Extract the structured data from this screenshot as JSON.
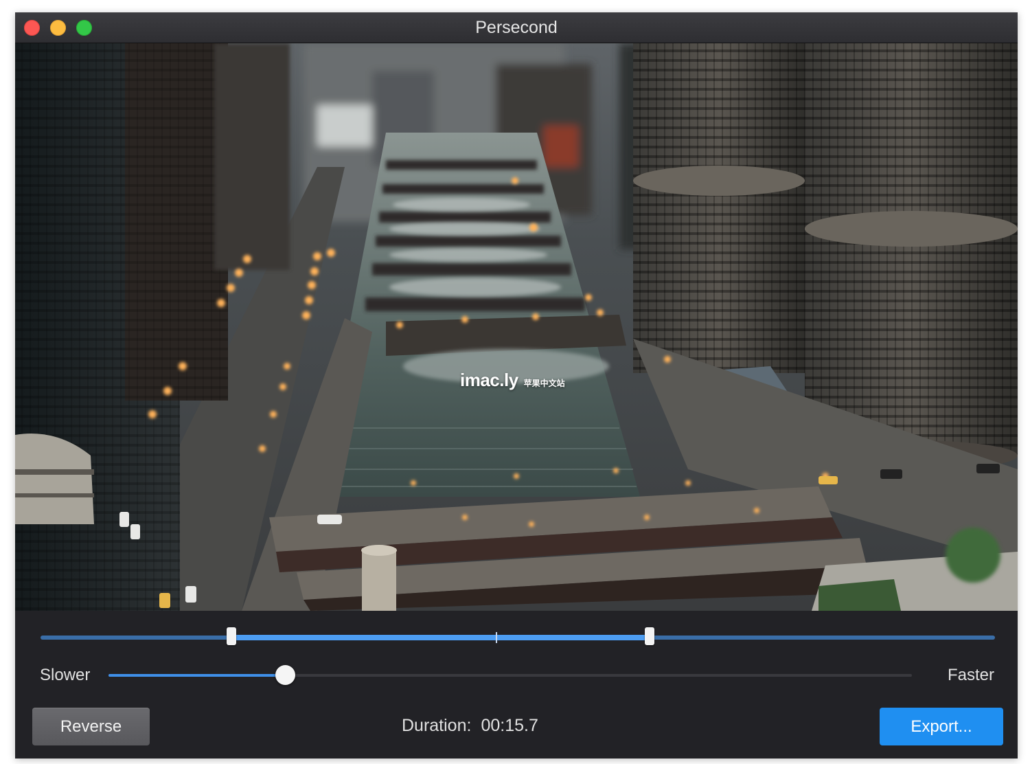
{
  "window": {
    "title": "Persecond"
  },
  "video": {
    "watermark_brand": "imac.ly",
    "watermark_sub": "苹果中文站"
  },
  "trim_range": {
    "start_fraction": 0.2,
    "end_fraction": 0.64
  },
  "speed": {
    "slower_label": "Slower",
    "faster_label": "Faster",
    "value_fraction": 0.22
  },
  "footer": {
    "reverse_label": "Reverse",
    "duration_label": "Duration:",
    "duration_value": "00:15.7",
    "export_label": "Export..."
  },
  "colors": {
    "accent": "#1f8ff1",
    "traffic_close": "#fc5753",
    "traffic_minimize": "#fdbc40",
    "traffic_maximize": "#33c748"
  }
}
